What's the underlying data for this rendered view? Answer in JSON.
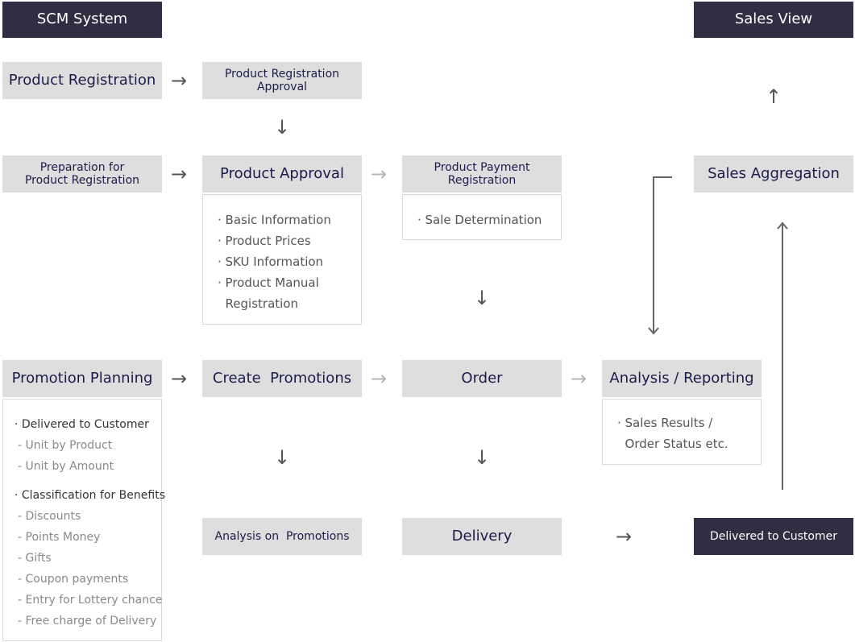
{
  "header": {
    "left_title": "SCM System",
    "right_title": "Sales View"
  },
  "row1": {
    "product_registration": "Product Registration",
    "product_registration_approval_l1": "Product Registration",
    "product_registration_approval_l2": "Approval"
  },
  "row2": {
    "preparation_l1": "Preparation for",
    "preparation_l2": "Product Registration",
    "product_approval": "Product Approval",
    "product_approval_details": [
      "· Basic Information",
      "· Product Prices",
      "· SKU Information",
      "· Product Manual",
      "  Registration"
    ],
    "product_payment_l1": "Product Payment",
    "product_payment_l2": "Registration",
    "product_payment_details": [
      "· Sale Determination"
    ],
    "sales_aggregation": "Sales Aggregation"
  },
  "row3": {
    "promotion_planning": "Promotion Planning",
    "promotion_planning_details": [
      {
        "text": "·  Delivered to Customer",
        "level": 1
      },
      {
        "text": "- Unit by Product",
        "level": 2
      },
      {
        "text": "- Unit by Amount",
        "level": 2
      },
      {
        "text": "· Classification for Benefits",
        "level": 1
      },
      {
        "text": "- Discounts",
        "level": 2
      },
      {
        "text": "- Points Money",
        "level": 2
      },
      {
        "text": "- Gifts",
        "level": 2
      },
      {
        "text": "- Coupon payments",
        "level": 2
      },
      {
        "text": "- Entry for Lottery chance",
        "level": 2
      },
      {
        "text": "- Free charge of Delivery",
        "level": 2
      }
    ],
    "create_promotions": "Create  Promotions",
    "order": "Order",
    "analysis_reporting": "Analysis / Reporting",
    "analysis_reporting_details": [
      "· Sales Results /",
      "  Order Status etc."
    ]
  },
  "row4": {
    "analysis_on_promotions": "Analysis on  Promotions",
    "delivery": "Delivery",
    "delivered_to_customer": "Delivered to Customer"
  },
  "arrows": {
    "right": "→",
    "down": "↓",
    "up": "↑"
  },
  "colors": {
    "dark_box": "#2f2e42",
    "gray_box": "#dedede",
    "text_navy": "#1c1b4a",
    "arrow_dark": "#555555",
    "arrow_light": "#b5b5b5"
  }
}
